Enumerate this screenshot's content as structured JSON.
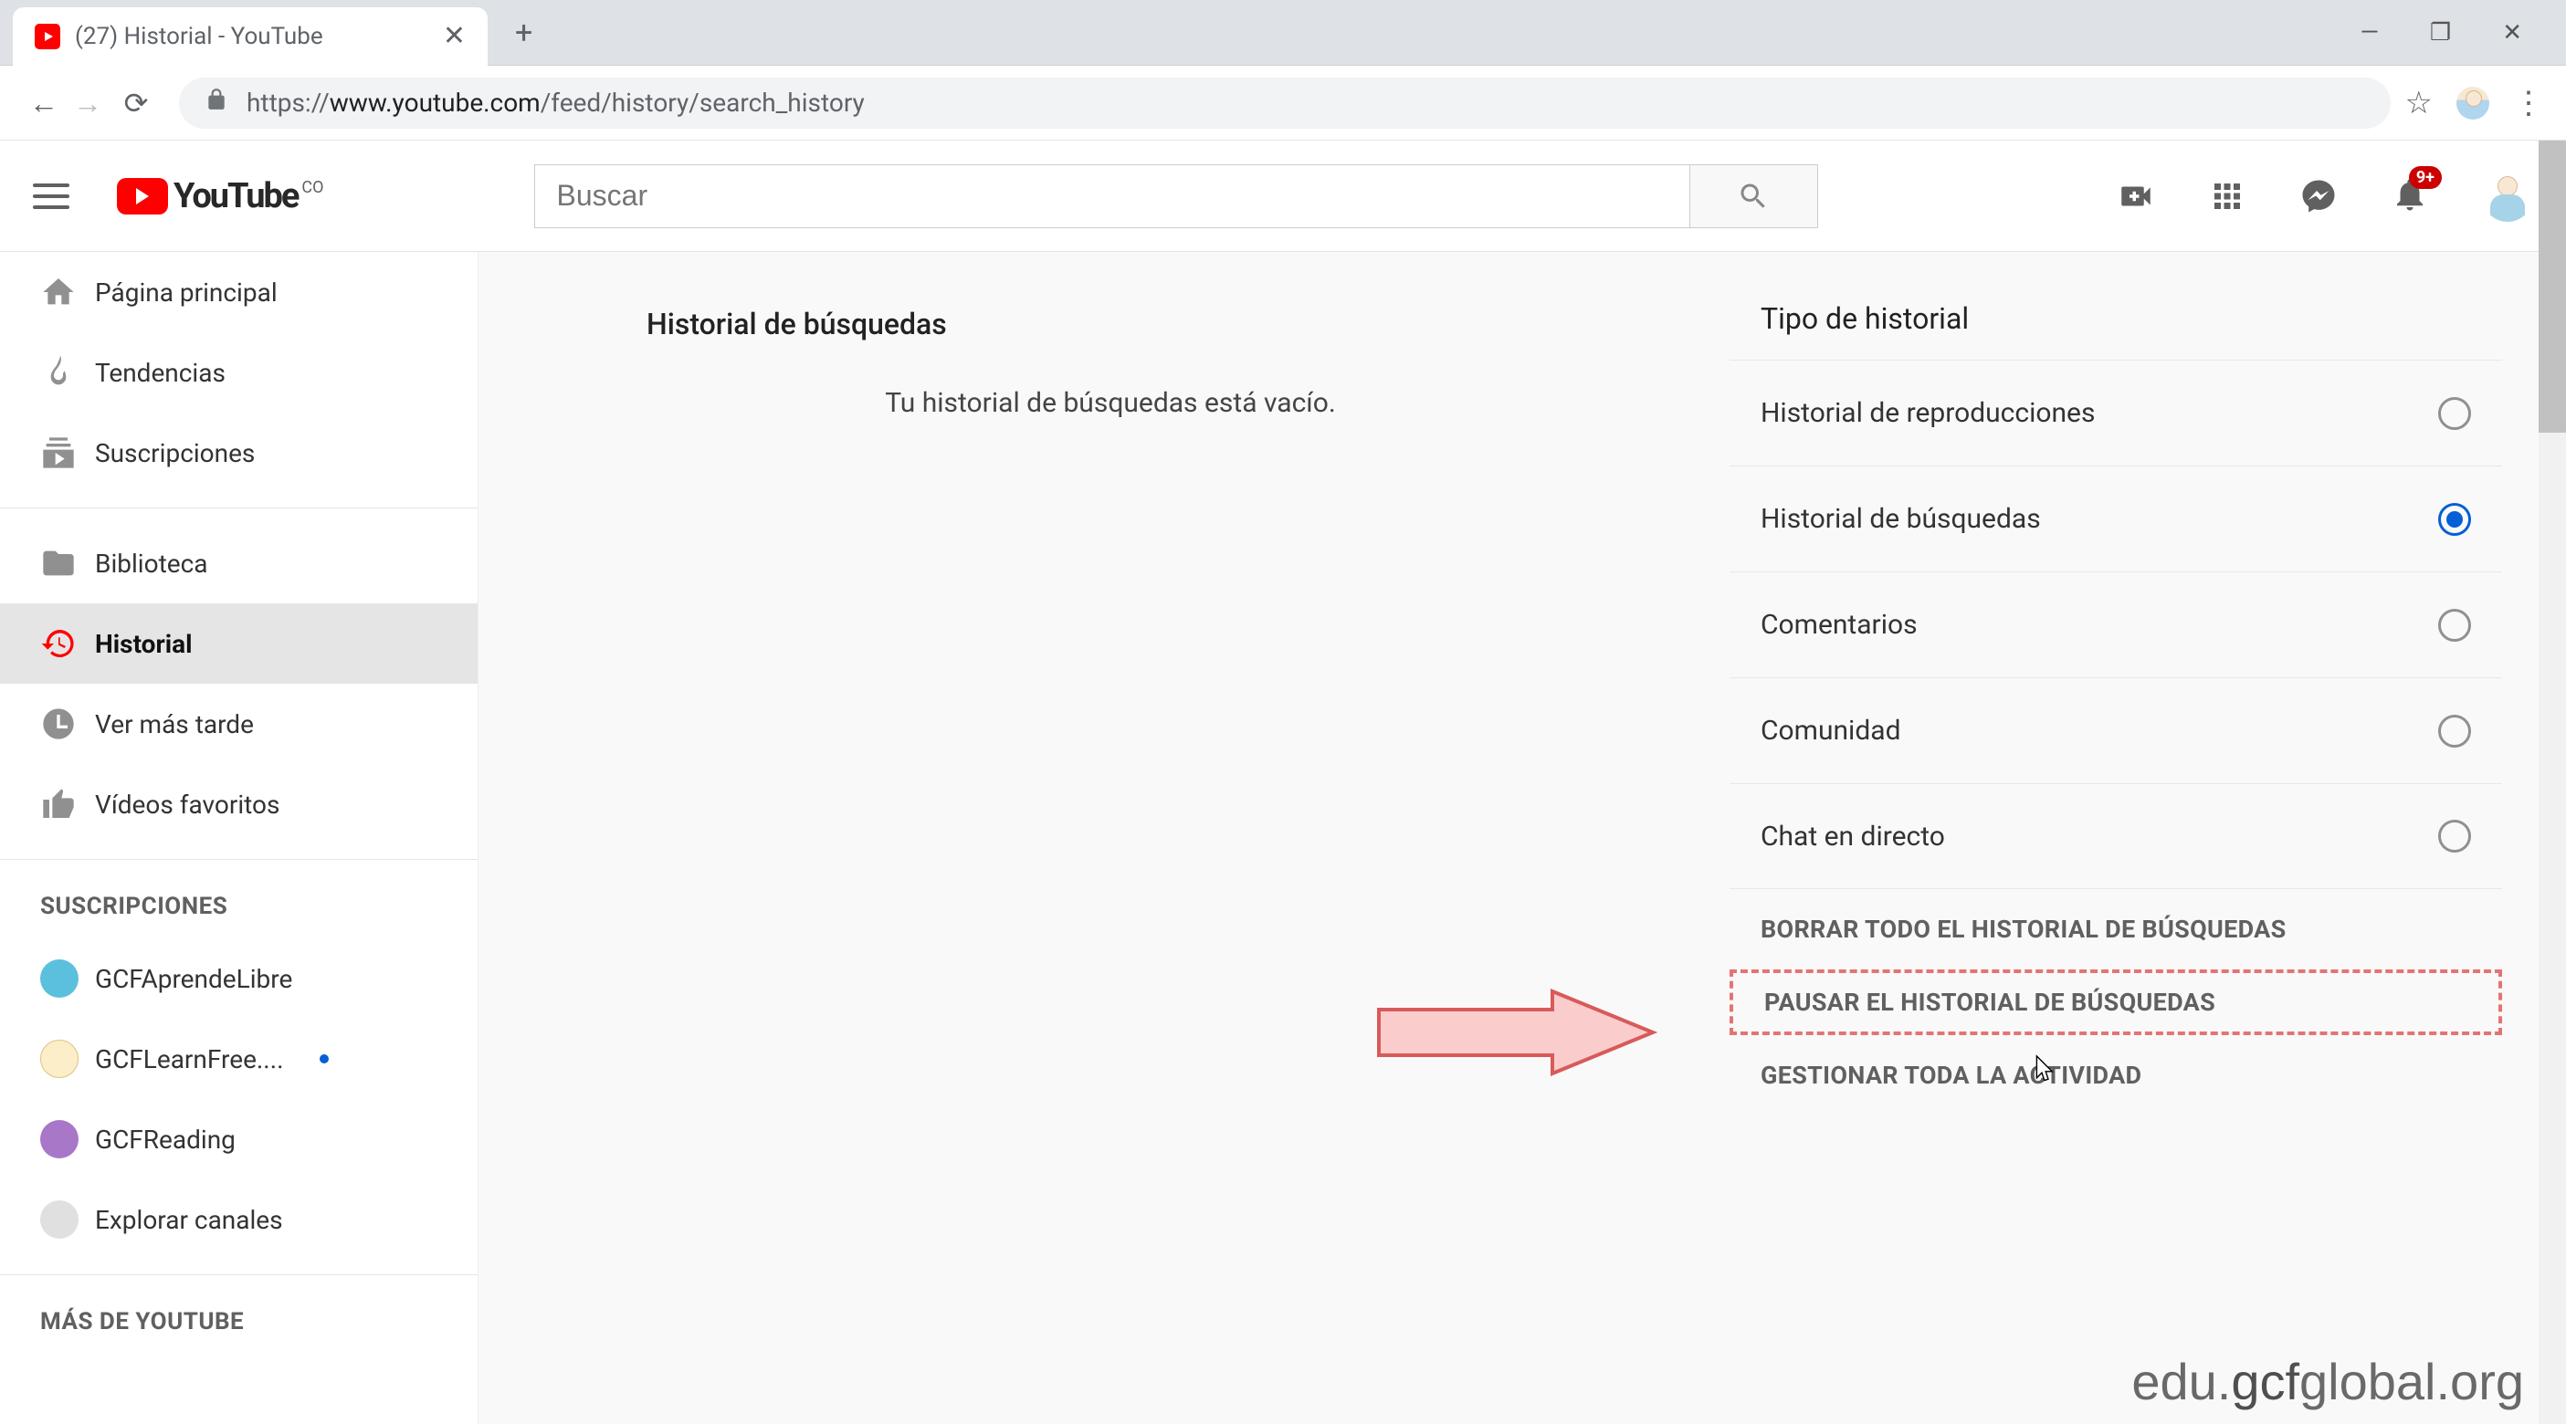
{
  "browser": {
    "tab_title": "(27) Historial - YouTube",
    "url_prefix": "https://",
    "url_host": "www.youtube.com",
    "url_path": "/feed/history/search_history"
  },
  "header": {
    "logo_text": "YouTube",
    "region": "CO",
    "search_placeholder": "Buscar",
    "notification_badge": "9+"
  },
  "sidebar": {
    "main_items": [
      {
        "label": "Página principal",
        "icon": "home"
      },
      {
        "label": "Tendencias",
        "icon": "fire"
      },
      {
        "label": "Suscripciones",
        "icon": "subs"
      }
    ],
    "library_items": [
      {
        "label": "Biblioteca",
        "icon": "folder"
      },
      {
        "label": "Historial",
        "icon": "history",
        "active": true
      },
      {
        "label": "Ver más tarde",
        "icon": "clock"
      },
      {
        "label": "Vídeos favoritos",
        "icon": "thumb"
      }
    ],
    "subs_heading": "SUSCRIPCIONES",
    "subs": [
      {
        "label": "GCFAprendeLibre",
        "color": "c1"
      },
      {
        "label": "GCFLearnFree....",
        "color": "c2",
        "dot": true
      },
      {
        "label": "GCFReading",
        "color": "c3"
      },
      {
        "label": "Explorar canales",
        "color": "c4"
      }
    ],
    "more_heading": "MÁS DE YOUTUBE"
  },
  "center": {
    "title": "Historial de búsquedas",
    "empty": "Tu historial de búsquedas está vacío."
  },
  "right": {
    "title": "Tipo de historial",
    "options": [
      {
        "label": "Historial de reproducciones",
        "checked": false
      },
      {
        "label": "Historial de búsquedas",
        "checked": true
      },
      {
        "label": "Comentarios",
        "checked": false
      },
      {
        "label": "Comunidad",
        "checked": false
      },
      {
        "label": "Chat en directo",
        "checked": false
      }
    ],
    "actions": {
      "clear": "BORRAR TODO EL HISTORIAL DE BÚSQUEDAS",
      "pause": "PAUSAR EL HISTORIAL DE BÚSQUEDAS",
      "manage": "GESTIONAR TODA LA ACTIVIDAD"
    }
  },
  "watermark": {
    "pre": "edu.",
    "mid": "gcf",
    "post": "global.org"
  }
}
